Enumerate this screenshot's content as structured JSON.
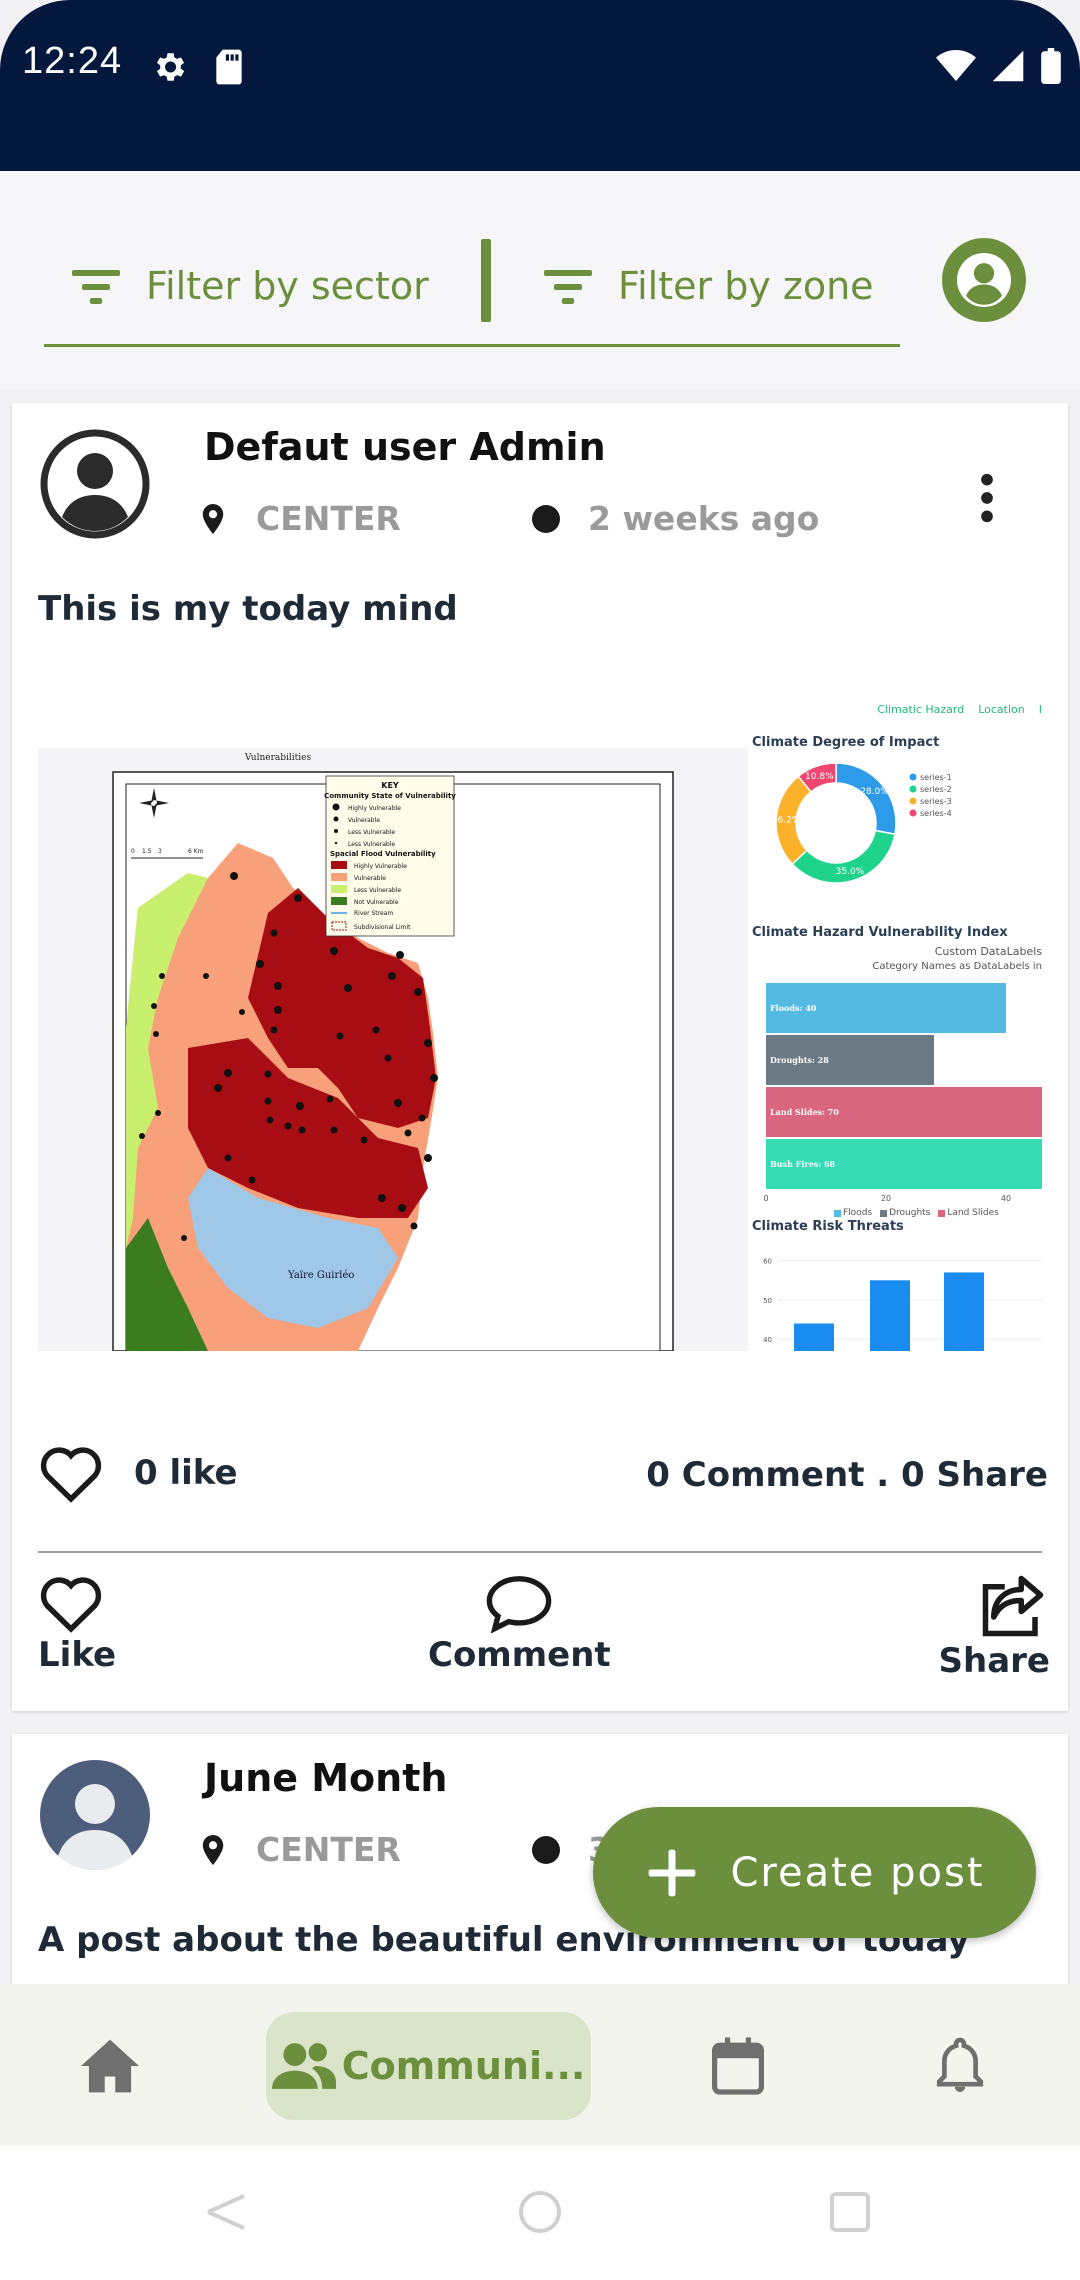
{
  "status_bar": {
    "time": "12:24"
  },
  "filters": {
    "sector_label": "Filter by sector",
    "zone_label": "Filter by zone"
  },
  "posts": [
    {
      "author": "Defaut user Admin",
      "location": "CENTER",
      "time": "2 weeks ago",
      "text": "This is my today mind",
      "image": {
        "map_title": "Vulnerabilities",
        "map_key_title": "KEY",
        "map_key_subtitle": "Community State of Vulnerability",
        "map_key_items": [
          "Highly Vulnerable",
          "Vulnerable",
          "Less Vulnerable",
          "Less Vulnerable"
        ],
        "map_flood_title": "Spacial Flood Vulnerability",
        "map_flood_items": [
          "Highly Vulnerable",
          "Vulnerable",
          "Less Vulnerable",
          "Not Vulnerable",
          "River Stream",
          "Subdivisional Limit"
        ],
        "map_scale": [
          "0",
          "1.5",
          "3",
          "6 Km"
        ],
        "map_lake": "Yaïre Guirléo",
        "dash_nav": [
          "Climatic Hazard",
          "Location",
          "I"
        ],
        "donut_title": "Climate Degree of Impact",
        "donut_labels": [
          "28.0%",
          "35.0%",
          "26.2%",
          "10.8%"
        ],
        "donut_legend": [
          "series-1",
          "series-2",
          "series-3",
          "series-4"
        ],
        "bar_title": "Climate Hazard Vulnerability Index",
        "bar_subtitle_1": "Custom DataLabels",
        "bar_subtitle_2": "Category Names as DataLabels in",
        "bar_labels": [
          "Floods: 40",
          "Droughts: 28",
          "Land Slides: 70",
          "Bush Fires: 68"
        ],
        "bar_axis": [
          "0",
          "20",
          "40"
        ],
        "bar_legend": [
          "Floods",
          "Droughts",
          "Land Slides"
        ],
        "risk_title": "Climate Risk Threats",
        "risk_axis": [
          "60",
          "50",
          "40"
        ]
      },
      "likes": "0 like",
      "comments_shares": "0 Comment . 0 Share"
    },
    {
      "author": "June Month",
      "location": "CENTER",
      "time": "3",
      "text": "A post about the beautiful environment of today"
    }
  ],
  "actions": {
    "like": "Like",
    "comment": "Comment",
    "share": "Share"
  },
  "fab": {
    "label": "Create post"
  },
  "bottom_nav": {
    "community": "Communi..."
  },
  "colors": {
    "accent": "#6b8f3c",
    "status_bar": "#04173d",
    "nav_active_bg": "#d9e4c8"
  },
  "chart_data": [
    {
      "type": "pie",
      "title": "Climate Degree of Impact",
      "labels": [
        "series-1",
        "series-2",
        "series-3",
        "series-4"
      ],
      "values": [
        28.0,
        35.0,
        26.2,
        10.8
      ],
      "colors": [
        "#2e9bea",
        "#1fd38a",
        "#fbb22a",
        "#ef476f"
      ]
    },
    {
      "type": "bar",
      "title": "Climate Hazard Vulnerability Index",
      "categories": [
        "Floods",
        "Droughts",
        "Land Slides",
        "Bush Fires"
      ],
      "values": [
        40,
        28,
        70,
        68
      ],
      "xlim": [
        0,
        50
      ],
      "colors": [
        "#54b9e3",
        "#6c7a86",
        "#d9657f",
        "#36dcb4"
      ]
    },
    {
      "type": "bar",
      "title": "Climate Risk Threats",
      "values": [
        44,
        55,
        57
      ],
      "ylim": [
        37,
        65
      ]
    }
  ]
}
